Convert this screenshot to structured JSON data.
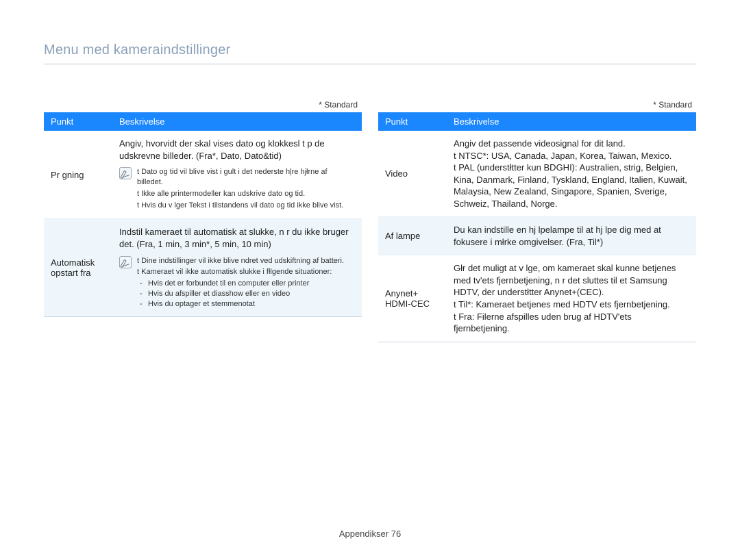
{
  "title": "Menu med kameraindstillinger",
  "standard_note": "* Standard",
  "headers": {
    "punkt": "Punkt",
    "beskrivelse": "Beskrivelse"
  },
  "left": [
    {
      "punkt": "Pr gning",
      "main": "Angiv, hvorvidt der skal vises dato og klokkesl t p de udskrevne billeder. (Fra*, Dato, Dato&tid)",
      "notes": [
        "t  Dato og tid vil blive vist i gult i det nederste hļre hjłrne af billedet.",
        "t  Ikke alle printermodeller kan udskrive dato og tid.",
        "t  Hvis du v lger Tekst i tilstandens        vil dato og tid ikke blive vist."
      ],
      "subs": [],
      "alt": false
    },
    {
      "punkt": "Automatisk opstart fra",
      "main": "Indstil kameraet til automatisk at slukke, n r du ikke bruger det. (Fra, 1 min, 3 min*, 5 min, 10 min)",
      "notes": [
        "t  Dine indstillinger vil ikke blive  ndret ved udskiftning af batteri.",
        "t  Kameraet vil ikke automatisk slukke i fłlgende situationer:"
      ],
      "subs": [
        "Hvis det er forbundet til en computer eller printer",
        "Hvis du afspiller et diasshow eller en video",
        "Hvis du optager et stemmenotat"
      ],
      "alt": true
    }
  ],
  "right": [
    {
      "punkt": "Video",
      "main": "Angiv det passende videosignal for dit land.",
      "bullets": [
        "t  NTSC*: USA, Canada, Japan, Korea, Taiwan, Mexico.",
        "t  PAL (understłtter kun BDGHI): Australien,  strig, Belgien, Kina, Danmark, Finland, Tyskland, England, Italien, Kuwait, Malaysia, New Zealand, Singapore, Spanien, Sverige, Schweiz, Thailand, Norge."
      ],
      "alt": false
    },
    {
      "punkt": "Af lampe",
      "main": "Du kan indstille en hj lpelampe til at hj lpe dig med at fokusere i młrke omgivelser. (Fra, Til*)",
      "bullets": [],
      "alt": true
    },
    {
      "punkt": "Anynet+ HDMI-CEC",
      "main": "Głr det muligt at v lge, om kameraet skal kunne betjenes med tv'ets fjernbetjening, n r det sluttes til et Samsung HDTV, der understłtter Anynet+(CEC).",
      "bullets": [
        "t  Til*: Kameraet betjenes med HDTV ets fjernbetjening.",
        "t  Fra: Filerne afspilles uden brug af HDTV'ets fjernbetjening."
      ],
      "alt": false
    }
  ],
  "footer": {
    "label": "Appendikser",
    "page": "76"
  }
}
